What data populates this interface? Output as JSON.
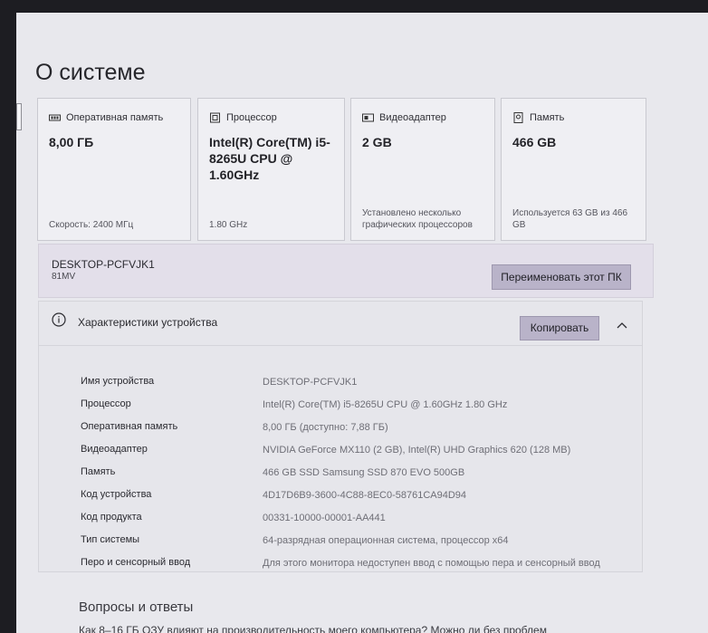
{
  "page": {
    "title": "О системе"
  },
  "cards": [
    {
      "label": "Оперативная память",
      "value": "8,00 ГБ",
      "note": "Скорость: 2400 МГц",
      "icon": "ram-icon"
    },
    {
      "label": "Процессор",
      "value": "Intel(R) Core(TM) i5-8265U CPU @ 1.60GHz",
      "note": "1.80 GHz",
      "icon": "processor-icon"
    },
    {
      "label": "Видеоадаптер",
      "value": "2 GB",
      "note": "Установлено несколько графических процессоров",
      "icon": "gpu-icon"
    },
    {
      "label": "Память",
      "value": "466 GB",
      "note": "Используется 63 GB из 466 GB",
      "icon": "storage-icon"
    }
  ],
  "device": {
    "name": "DESKTOP-PCFVJK1",
    "model": "81MV",
    "rename_label": "Переименовать этот ПК"
  },
  "specs": {
    "title": "Характеристики устройства",
    "copy_label": "Копировать",
    "rows": [
      {
        "key": "Имя устройства",
        "value": "DESKTOP-PCFVJK1"
      },
      {
        "key": "Процессор",
        "value": "Intel(R) Core(TM) i5-8265U CPU @ 1.60GHz   1.80 GHz"
      },
      {
        "key": "Оперативная память",
        "value": "8,00 ГБ (доступно: 7,88 ГБ)"
      },
      {
        "key": "Видеоадаптер",
        "value": "NVIDIA GeForce MX110 (2 GB), Intel(R) UHD Graphics 620 (128 MB)"
      },
      {
        "key": "Память",
        "value": "466 GB SSD Samsung SSD 870 EVO 500GB"
      },
      {
        "key": "Код устройства",
        "value": "4D17D6B9-3600-4C88-8EC0-58761CA94D94"
      },
      {
        "key": "Код продукта",
        "value": "00331-10000-00001-AA441"
      },
      {
        "key": "Тип системы",
        "value": "64-разрядная операционная система, процессор x64"
      },
      {
        "key": "Перо и сенсорный ввод",
        "value": "Для этого монитора недоступен ввод с помощью пера и сенсорный ввод"
      }
    ]
  },
  "faq": {
    "title": "Вопросы и ответы",
    "link": "Как 8–16 ГБ ОЗУ влияют на производительность моего компьютера? Можно ли без проблем"
  }
}
